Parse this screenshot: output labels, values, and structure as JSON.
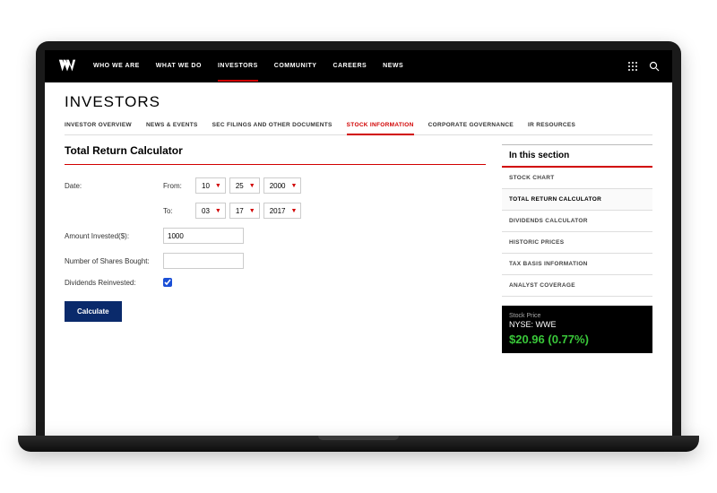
{
  "topnav": {
    "items": [
      "WHO WE ARE",
      "WHAT WE DO",
      "INVESTORS",
      "COMMUNITY",
      "CAREERS",
      "NEWS"
    ],
    "activeIndex": 2
  },
  "pageTitle": "INVESTORS",
  "subnav": {
    "items": [
      "INVESTOR OVERVIEW",
      "NEWS & EVENTS",
      "SEC FILINGS AND OTHER DOCUMENTS",
      "STOCK INFORMATION",
      "CORPORATE GOVERNANCE",
      "IR RESOURCES"
    ],
    "activeIndex": 3
  },
  "calc": {
    "title": "Total Return Calculator",
    "dateLabel": "Date:",
    "fromLabel": "From:",
    "toLabel": "To:",
    "from": {
      "month": "10",
      "day": "25",
      "year": "2000"
    },
    "to": {
      "month": "03",
      "day": "17",
      "year": "2017"
    },
    "amountLabel": "Amount Invested($):",
    "amountValue": "1000",
    "sharesLabel": "Number of Shares Bought:",
    "sharesValue": "",
    "dividendsLabel": "Dividends Reinvested:",
    "dividendsChecked": true,
    "button": "Calculate"
  },
  "sideSection": {
    "heading": "In this section",
    "items": [
      "STOCK CHART",
      "TOTAL RETURN CALCULATOR",
      "DIVIDENDS CALCULATOR",
      "HISTORIC PRICES",
      "TAX BASIS INFORMATION",
      "ANALYST COVERAGE"
    ],
    "activeIndex": 1
  },
  "stock": {
    "label": "Stock Price",
    "symbol": "NYSE: WWE",
    "price": "$20.96 (0.77%)"
  }
}
